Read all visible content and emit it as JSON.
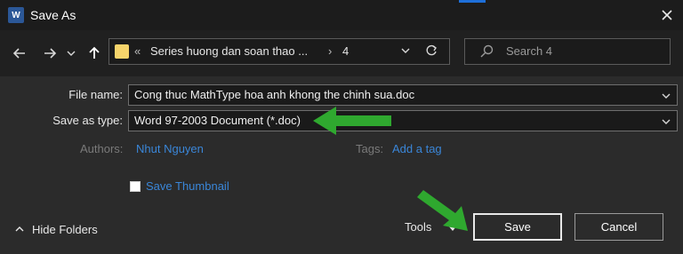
{
  "window": {
    "title": "Save As",
    "app_icon_text": "W"
  },
  "nav": {
    "breadcrumb_prefix": "«",
    "breadcrumb_folder": "Series huong dan soan thao ...",
    "breadcrumb_separator": "›",
    "breadcrumb_current": "4",
    "search_placeholder": "Search 4"
  },
  "form": {
    "file_name_label": "File name:",
    "file_name_value": "Cong thuc MathType hoa anh khong the chinh sua.doc",
    "save_type_label": "Save as type:",
    "save_type_value": "Word 97-2003 Document (*.doc)",
    "authors_label": "Authors:",
    "authors_value": "Nhut Nguyen",
    "tags_label": "Tags:",
    "tags_value": "Add a tag",
    "thumbnail_label": "Save Thumbnail"
  },
  "footer": {
    "hide_folders_label": "Hide Folders",
    "tools_label": "Tools",
    "save_label": "Save",
    "cancel_label": "Cancel"
  },
  "colors": {
    "annotation_arrow": "#2fa82f",
    "link": "#3a86d8",
    "background": "#2b2b2b"
  }
}
